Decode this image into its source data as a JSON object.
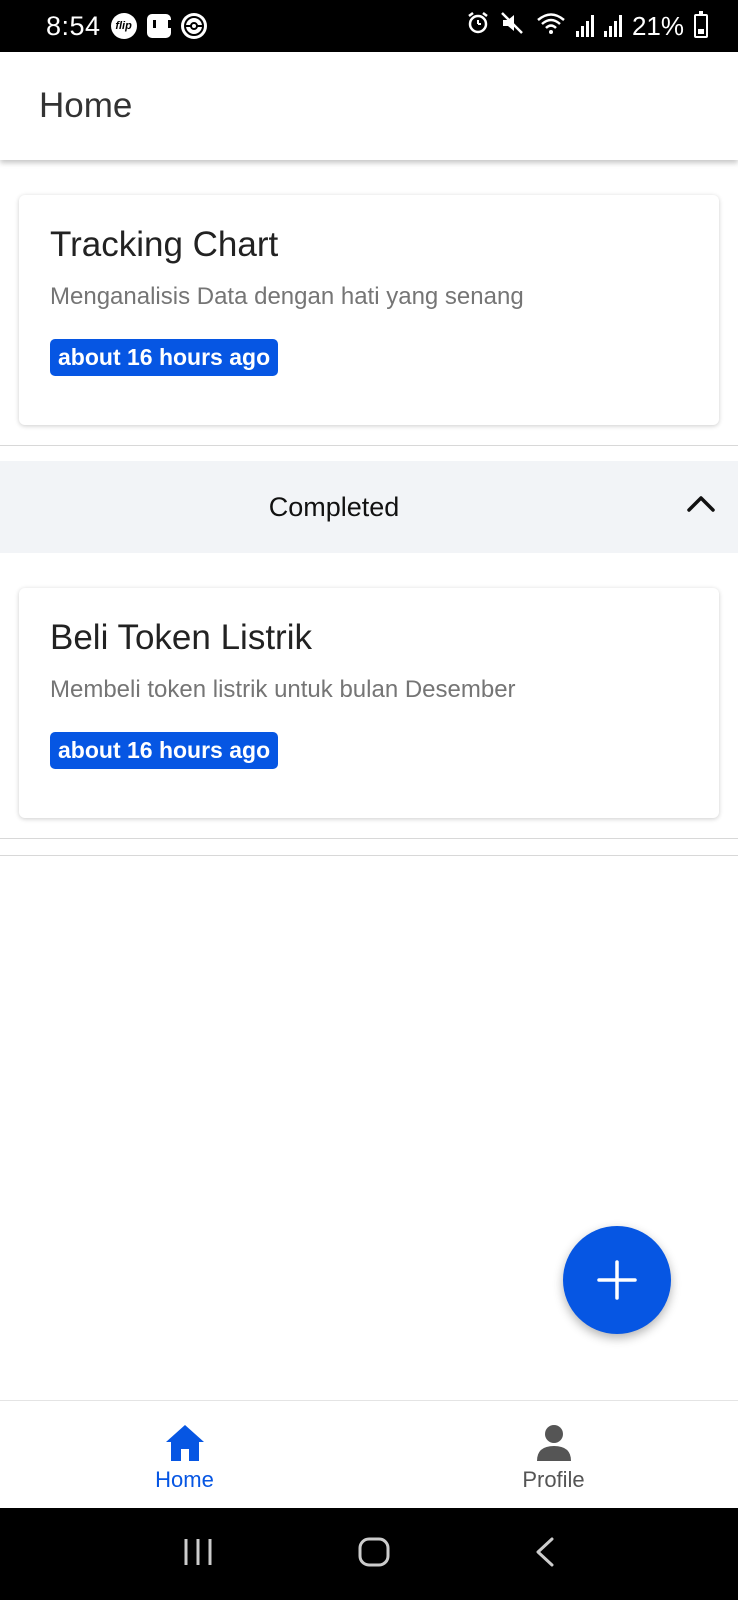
{
  "status_bar": {
    "time": "8:54",
    "notif_badge": "flip",
    "battery": "21%"
  },
  "app_bar": {
    "title": "Home"
  },
  "tasks": [
    {
      "title": "Tracking Chart",
      "description": "Menganalisis Data dengan hati yang senang",
      "timestamp": "about 16 hours ago"
    }
  ],
  "completed_section": {
    "label": "Completed",
    "expanded": true,
    "tasks": [
      {
        "title": "Beli Token Listrik",
        "description": "Membeli token listrik untuk bulan Desember",
        "timestamp": "about 16 hours ago"
      }
    ]
  },
  "bottom_nav": {
    "items": [
      {
        "label": "Home",
        "icon": "home-icon",
        "active": true
      },
      {
        "label": "Profile",
        "icon": "person-icon",
        "active": false
      }
    ]
  },
  "colors": {
    "accent": "#0656e3",
    "section_bg": "#f2f4f7"
  }
}
